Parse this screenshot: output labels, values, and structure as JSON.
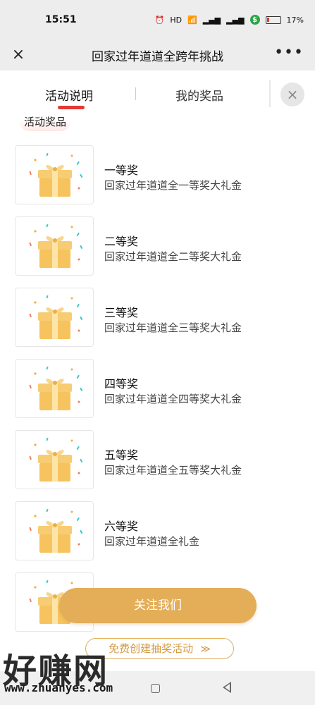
{
  "status_bar": {
    "time": "15:51",
    "icons": [
      "alarm-icon",
      "hd-icon",
      "wifi-icon",
      "signal-icon",
      "signal-icon",
      "dollar-icon",
      "battery-icon"
    ],
    "hd": "HD",
    "battery": "17%"
  },
  "nav": {
    "close_icon": "×",
    "title": "回家过年道道全跨年挑战",
    "more_icon": "•••"
  },
  "tabs": {
    "items": [
      {
        "label": "活动说明",
        "active": true
      },
      {
        "label": "我的奖品",
        "active": false
      }
    ],
    "close_icon": "×"
  },
  "section": {
    "heading": "活动奖品"
  },
  "prizes": [
    {
      "name": "一等奖",
      "desc": "回家过年道道全一等奖大礼金"
    },
    {
      "name": "二等奖",
      "desc": "回家过年道道全二等奖大礼金"
    },
    {
      "name": "三等奖",
      "desc": "回家过年道道全三等奖大礼金"
    },
    {
      "name": "四等奖",
      "desc": "回家过年道道全四等奖大礼金"
    },
    {
      "name": "五等奖",
      "desc": "回家过年道道全五等奖大礼金"
    },
    {
      "name": "六等奖",
      "desc": "回家过年道道全礼金"
    },
    {
      "name": "",
      "desc": ""
    }
  ],
  "actions": {
    "follow_label": "关注我们",
    "create_label": "免费创建抽奖活动",
    "create_chevron": "≫"
  },
  "watermark": {
    "brand": "好赚网",
    "url": "www.zhuanyes.com"
  },
  "colors": {
    "accent": "#e4ad58",
    "tab_underline": "#e53935",
    "nav_bg": "#ededed"
  }
}
